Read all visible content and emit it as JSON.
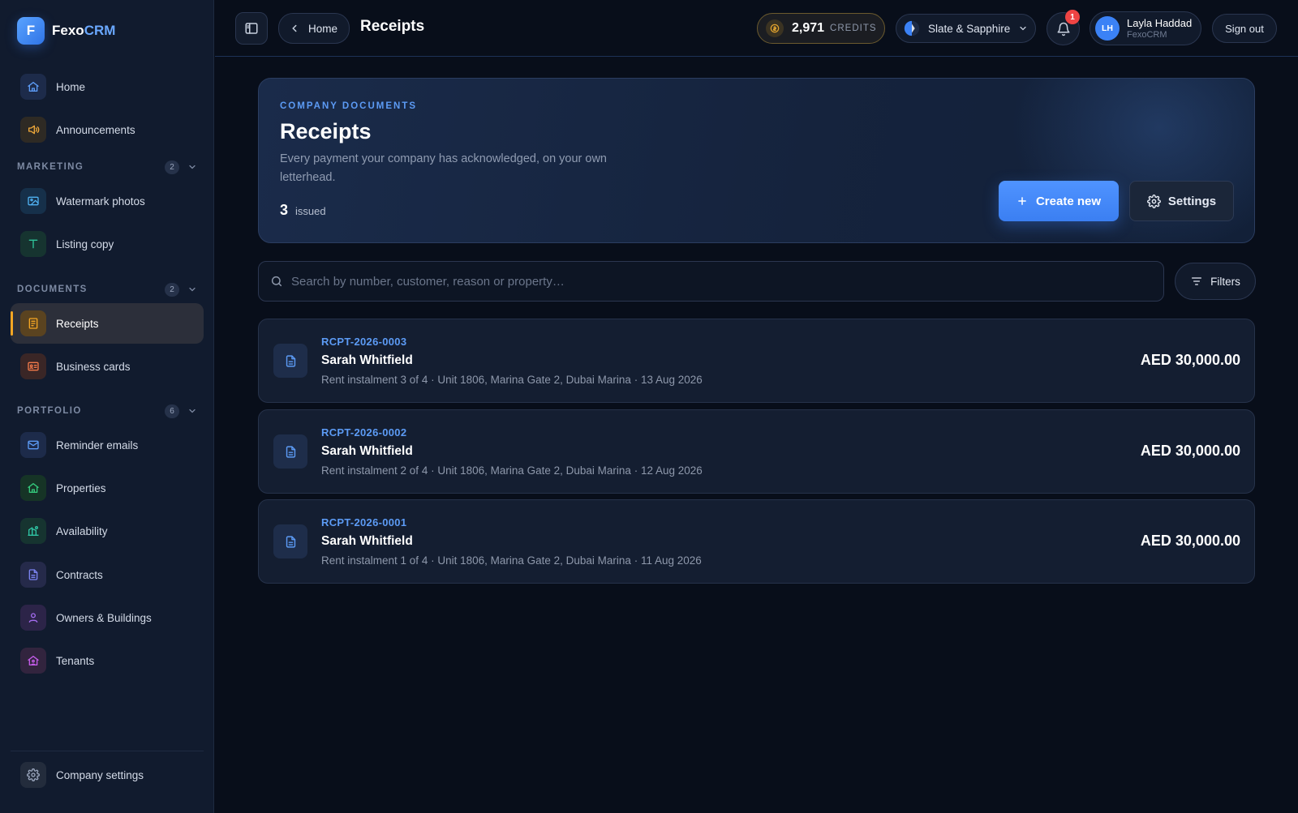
{
  "brand": {
    "initial": "F",
    "name_part1": "Fexo",
    "name_part2": "CRM"
  },
  "sidebar": {
    "top_items": [
      {
        "label": "Home",
        "icon": "home-icon"
      },
      {
        "label": "Announcements",
        "icon": "megaphone-icon"
      }
    ],
    "sections": [
      {
        "label": "MARKETING",
        "count": "2",
        "items": [
          {
            "label": "Watermark photos",
            "icon": "image-icon"
          },
          {
            "label": "Listing copy",
            "icon": "text-icon"
          }
        ]
      },
      {
        "label": "DOCUMENTS",
        "count": "2",
        "items": [
          {
            "label": "Receipts",
            "icon": "receipt-icon",
            "active": true
          },
          {
            "label": "Business cards",
            "icon": "id-card-icon"
          }
        ]
      },
      {
        "label": "PORTFOLIO",
        "count": "6",
        "items": [
          {
            "label": "Reminder emails",
            "icon": "mail-icon"
          },
          {
            "label": "Properties",
            "icon": "house-icon"
          },
          {
            "label": "Availability",
            "icon": "building-icon"
          },
          {
            "label": "Contracts",
            "icon": "document-icon"
          },
          {
            "label": "Owners & Buildings",
            "icon": "user-icon"
          },
          {
            "label": "Tenants",
            "icon": "home-person-icon"
          }
        ]
      }
    ],
    "footer_item": {
      "label": "Company settings",
      "icon": "gear-icon"
    }
  },
  "topbar": {
    "back_label": "Home",
    "page_title": "Receipts",
    "credits": {
      "value": "2,971",
      "label": "CREDITS"
    },
    "theme_label": "Slate & Sapphire",
    "notifications_count": "1",
    "user": {
      "initials": "LH",
      "name": "Layla Haddad",
      "company": "FexoCRM"
    },
    "signout_label": "Sign out"
  },
  "hero": {
    "eyebrow": "COMPANY DOCUMENTS",
    "title": "Receipts",
    "description": "Every payment your company has acknowledged, on your own letterhead.",
    "count": "3",
    "count_label": "issued",
    "create_label": "Create new",
    "settings_label": "Settings"
  },
  "search": {
    "placeholder": "Search by number, customer, reason or property…",
    "value": ""
  },
  "filters_label": "Filters",
  "receipts": [
    {
      "number": "RCPT-2026-0003",
      "customer": "Sarah Whitfield",
      "details": "Rent instalment 3 of 4 · Unit 1806, Marina Gate 2, Dubai Marina · 13 Aug 2026",
      "amount": "AED 30,000.00"
    },
    {
      "number": "RCPT-2026-0002",
      "customer": "Sarah Whitfield",
      "details": "Rent instalment 2 of 4 · Unit 1806, Marina Gate 2, Dubai Marina · 12 Aug 2026",
      "amount": "AED 30,000.00"
    },
    {
      "number": "RCPT-2026-0001",
      "customer": "Sarah Whitfield",
      "details": "Rent instalment 1 of 4 · Unit 1806, Marina Gate 2, Dubai Marina · 11 Aug 2026",
      "amount": "AED 30,000.00"
    }
  ],
  "colors": {
    "accent": "#3b82f6",
    "active_marker": "#f5a623",
    "background": "#080e1a",
    "sidebar": "#111b2e"
  }
}
